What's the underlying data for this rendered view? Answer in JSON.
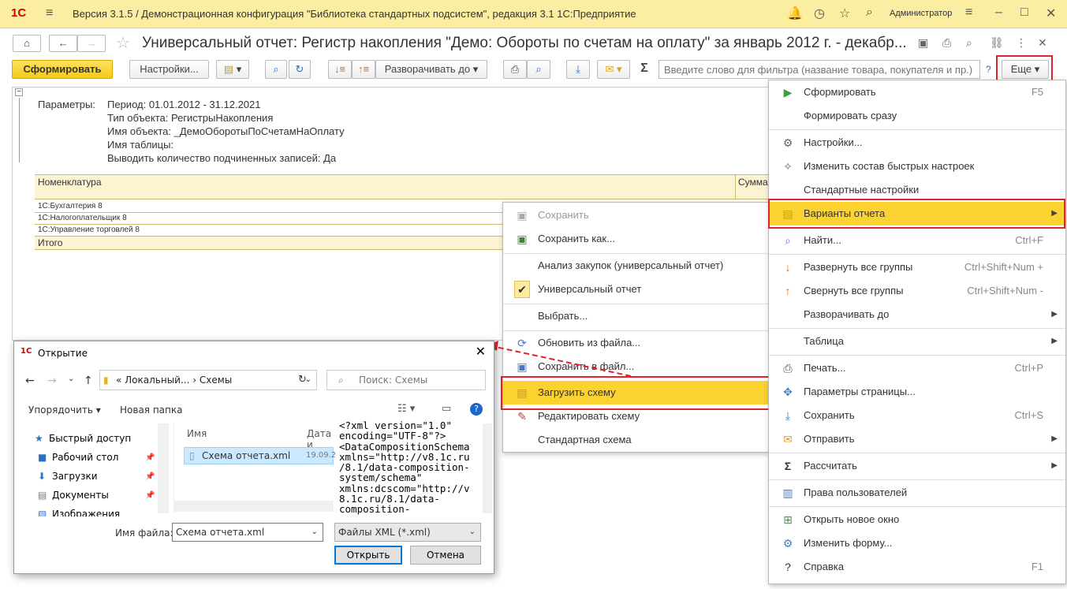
{
  "window": {
    "logo": "1С",
    "title": "Версия 3.1.5 / Демонстрационная конфигурация \"Библиотека стандартных подсистем\", редакция 3.1 1С:Предприятие",
    "user": "Администратор"
  },
  "form": {
    "title": "Универсальный отчет: Регистр накопления \"Демо: Обороты по счетам на оплату\" за январь 2012 г. - декабр..."
  },
  "toolbar": {
    "generate": "Сформировать",
    "settings": "Настройки...",
    "expand_to": "Разворачивать до",
    "sigma": "Σ",
    "filter_placeholder": "Введите слово для фильтра (название товара, покупателя и пр.)",
    "help": "?",
    "more": "Еще"
  },
  "report": {
    "params_label": "Параметры:",
    "params": [
      "Период: 01.01.2012 - 31.12.2021",
      "Тип объекта: РегистрыНакопления",
      "Имя объекта: _ДемоОборотыПоСчетамНаОплату",
      "Имя таблицы:",
      "Выводить количество подчиненных записей: Да"
    ],
    "col_nomenclature": "Номенклатура",
    "col_sum": "Сумма",
    "rows": [
      "1С:Бухгалтерия 8",
      "1С:Налогоплательщик 8",
      "1С:Управление торговлей 8"
    ],
    "total": "Итого"
  },
  "submenu": {
    "items": [
      {
        "label": "Сохранить",
        "icon": "save-icon"
      },
      {
        "label": "Сохранить как...",
        "icon": "save-as-icon"
      },
      {
        "label": "Анализ закупок (универсальный отчет)",
        "icon": ""
      },
      {
        "label": "Универсальный отчет",
        "icon": "checkmark-icon"
      },
      {
        "label": "Выбрать...",
        "icon": ""
      },
      {
        "label": "Обновить из файла...",
        "icon": "refresh-file-icon"
      },
      {
        "label": "Сохранить в файл...",
        "icon": "save-file-icon"
      },
      {
        "label": "Загрузить схему",
        "icon": "load-schema-icon"
      },
      {
        "label": "Редактировать схему",
        "icon": "edit-schema-icon"
      },
      {
        "label": "Стандартная схема",
        "icon": ""
      }
    ]
  },
  "mainmenu": {
    "items": [
      {
        "label": "Сформировать",
        "shortcut": "F5"
      },
      {
        "label": "Формировать сразу",
        "shortcut": ""
      },
      {
        "label": "Настройки...",
        "shortcut": ""
      },
      {
        "label": "Изменить состав быстрых настроек",
        "shortcut": ""
      },
      {
        "label": "Стандартные настройки",
        "shortcut": ""
      },
      {
        "label": "Варианты отчета",
        "shortcut": ""
      },
      {
        "label": "Найти...",
        "shortcut": "Ctrl+F"
      },
      {
        "label": "Развернуть все группы",
        "shortcut": "Ctrl+Shift+Num +"
      },
      {
        "label": "Свернуть все группы",
        "shortcut": "Ctrl+Shift+Num -"
      },
      {
        "label": "Разворачивать до",
        "shortcut": ""
      },
      {
        "label": "Таблица",
        "shortcut": ""
      },
      {
        "label": "Печать...",
        "shortcut": "Ctrl+P"
      },
      {
        "label": "Параметры страницы...",
        "shortcut": ""
      },
      {
        "label": "Сохранить",
        "shortcut": "Ctrl+S"
      },
      {
        "label": "Отправить",
        "shortcut": ""
      },
      {
        "label": "Рассчитать",
        "shortcut": ""
      },
      {
        "label": "Права пользователей",
        "shortcut": ""
      },
      {
        "label": "Открыть новое окно",
        "shortcut": ""
      },
      {
        "label": "Изменить форму...",
        "shortcut": ""
      },
      {
        "label": "Справка",
        "shortcut": "F1"
      }
    ]
  },
  "dialog": {
    "title": "Открытие",
    "address": "« Локальный... › Схемы",
    "search_placeholder": "Поиск: Схемы",
    "organize": "Упорядочить",
    "new_folder": "Новая папка",
    "nav": [
      "Быстрый доступ",
      "Рабочий стол",
      "Загрузки",
      "Документы",
      "Изображения"
    ],
    "col_name": "Имя",
    "col_date": "Дата и",
    "file_name": "Схема отчета.xml",
    "file_date": "19.09.2",
    "xml_preview": "<?xml version=\"1.0\"\nencoding=\"UTF-8\"?>\n<DataCompositionSchema\nxmlns=\"http://v8.1c.ru\n/8.1/data-composition-\nsystem/schema\"\nxmlns:dcscom=\"http://v\n8.1c.ru/8.1/data-\ncomposition-",
    "filename_label": "Имя файла:",
    "filename_value": "Схема отчета.xml",
    "filetype": "Файлы XML (*.xml)",
    "open": "Открыть",
    "cancel": "Отмена"
  },
  "colors": {
    "accent_yellow": "#fbd22f",
    "highlight_red": "#e0242c",
    "report_header_bg": "#fbf3d2"
  }
}
